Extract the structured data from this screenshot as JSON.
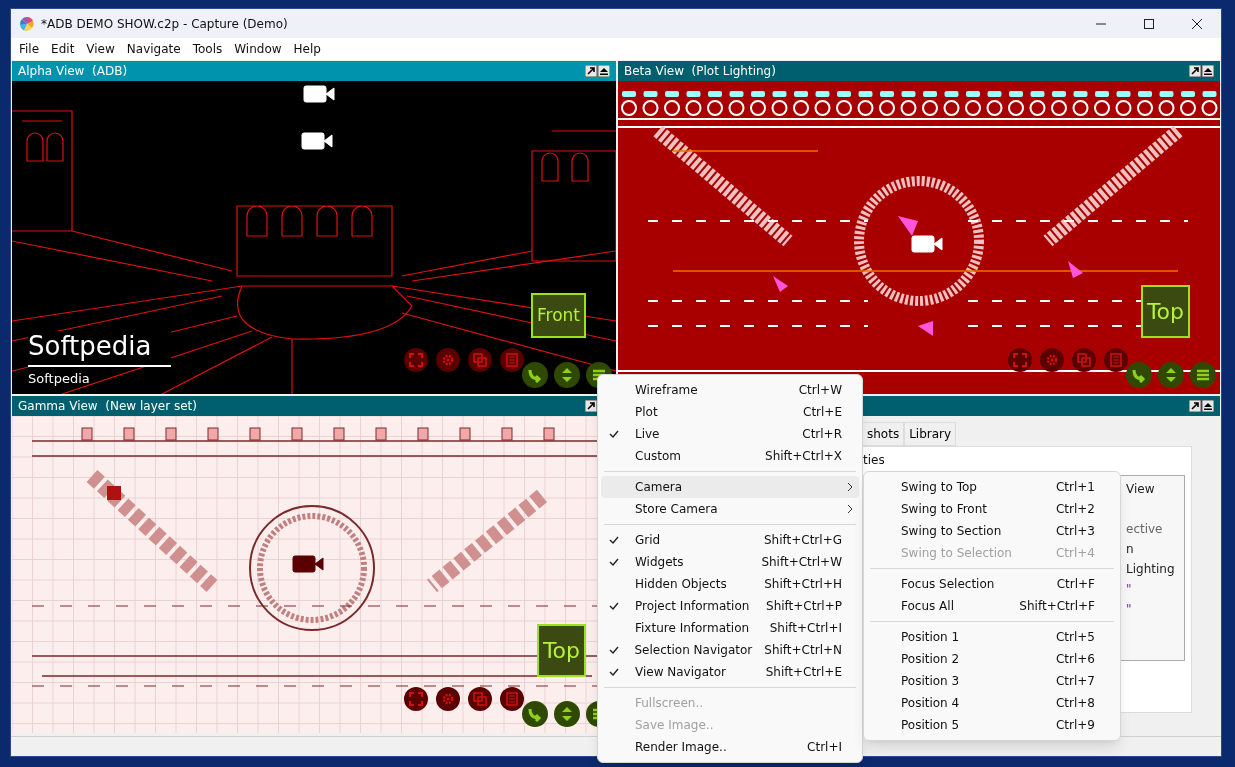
{
  "window": {
    "title": "*ADB DEMO SHOW.c2p - Capture (Demo)"
  },
  "menu_bar": [
    "File",
    "Edit",
    "View",
    "Navigate",
    "Tools",
    "Window",
    "Help"
  ],
  "views": [
    {
      "title": "Alpha View  (ADB)",
      "kind": "perspective",
      "active": false,
      "camera_label": "Front",
      "project_info": {
        "title": "Softpedia",
        "subtitle": "Softpedia"
      }
    },
    {
      "title": "Beta View  (Plot Lighting)",
      "kind": "plot",
      "active": true,
      "camera_label": "Top"
    },
    {
      "title": "Gamma View  (New layer set)",
      "kind": "plan",
      "active": true,
      "camera_label": "Top"
    }
  ],
  "side_panel": {
    "tabs": [
      {
        "label": "shots",
        "selected": false
      },
      {
        "label": "Library",
        "selected": false
      }
    ],
    "heading": "ties",
    "list_items": [
      "View",
      "ective",
      "n",
      "Lighting",
      "\"",
      "\""
    ]
  },
  "context_menu": [
    {
      "kind": "item",
      "label": "Wireframe",
      "shortcut": "Ctrl+W",
      "checked": false,
      "disabled": false
    },
    {
      "kind": "item",
      "label": "Plot",
      "shortcut": "Ctrl+E",
      "checked": false,
      "disabled": false
    },
    {
      "kind": "item",
      "label": "Live",
      "shortcut": "Ctrl+R",
      "checked": true,
      "disabled": false
    },
    {
      "kind": "item",
      "label": "Custom",
      "shortcut": "Shift+Ctrl+X",
      "checked": false,
      "disabled": false
    },
    {
      "kind": "separator"
    },
    {
      "kind": "submenu",
      "label": "Camera",
      "highlighted": true
    },
    {
      "kind": "submenu",
      "label": "Store Camera",
      "highlighted": false
    },
    {
      "kind": "separator"
    },
    {
      "kind": "item",
      "label": "Grid",
      "shortcut": "Shift+Ctrl+G",
      "checked": true,
      "disabled": false
    },
    {
      "kind": "item",
      "label": "Widgets",
      "shortcut": "Shift+Ctrl+W",
      "checked": true,
      "disabled": false
    },
    {
      "kind": "item",
      "label": "Hidden Objects",
      "shortcut": "Shift+Ctrl+H",
      "checked": false,
      "disabled": false
    },
    {
      "kind": "item",
      "label": "Project Information",
      "shortcut": "Shift+Ctrl+P",
      "checked": true,
      "disabled": false
    },
    {
      "kind": "item",
      "label": "Fixture Information",
      "shortcut": "Shift+Ctrl+I",
      "checked": false,
      "disabled": false
    },
    {
      "kind": "item",
      "label": "Selection Navigator",
      "shortcut": "Shift+Ctrl+N",
      "checked": true,
      "disabled": false
    },
    {
      "kind": "item",
      "label": "View Navigator",
      "shortcut": "Shift+Ctrl+E",
      "checked": true,
      "disabled": false
    },
    {
      "kind": "separator"
    },
    {
      "kind": "item",
      "label": "Fullscreen..",
      "checked": false,
      "disabled": true
    },
    {
      "kind": "item",
      "label": "Save Image..",
      "checked": false,
      "disabled": true
    },
    {
      "kind": "item",
      "label": "Render Image..",
      "shortcut": "Ctrl+I",
      "checked": false,
      "disabled": false
    }
  ],
  "camera_submenu": [
    {
      "kind": "item",
      "label": "Swing to Top",
      "shortcut": "Ctrl+1",
      "disabled": false
    },
    {
      "kind": "item",
      "label": "Swing to Front",
      "shortcut": "Ctrl+2",
      "disabled": false
    },
    {
      "kind": "item",
      "label": "Swing to Section",
      "shortcut": "Ctrl+3",
      "disabled": false
    },
    {
      "kind": "item",
      "label": "Swing to Selection",
      "shortcut": "Ctrl+4",
      "disabled": true
    },
    {
      "kind": "separator"
    },
    {
      "kind": "item",
      "label": "Focus Selection",
      "shortcut": "Ctrl+F",
      "disabled": false
    },
    {
      "kind": "item",
      "label": "Focus All",
      "shortcut": "Shift+Ctrl+F",
      "disabled": false
    },
    {
      "kind": "separator"
    },
    {
      "kind": "item",
      "label": "Position 1",
      "shortcut": "Ctrl+5",
      "disabled": false
    },
    {
      "kind": "item",
      "label": "Position 2",
      "shortcut": "Ctrl+6",
      "disabled": false
    },
    {
      "kind": "item",
      "label": "Position 3",
      "shortcut": "Ctrl+7",
      "disabled": false
    },
    {
      "kind": "item",
      "label": "Position 4",
      "shortcut": "Ctrl+8",
      "disabled": false
    },
    {
      "kind": "item",
      "label": "Position 5",
      "shortcut": "Ctrl+9",
      "disabled": false
    }
  ]
}
